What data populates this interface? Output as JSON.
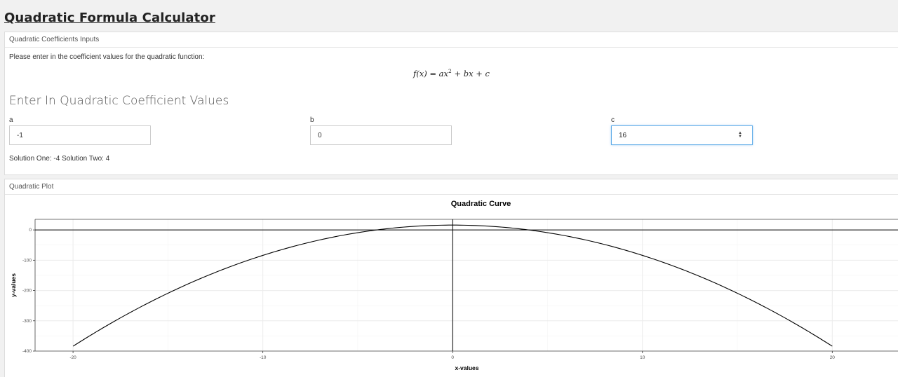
{
  "app": {
    "title": "Quadratic Formula Calculator"
  },
  "coefficients_panel": {
    "heading": "Quadratic Coefficients Inputs",
    "intro": "Please enter in the coefficient values for the quadratic function:",
    "formula": {
      "lhs": "f(x) = ax",
      "exp": "2",
      "rhs": " + bx + c"
    },
    "section_title": "Enter In Quadratic Coefficient Values",
    "fields": {
      "a": {
        "label": "a",
        "value": "-1"
      },
      "b": {
        "label": "b",
        "value": "0"
      },
      "c": {
        "label": "c",
        "value": "16"
      }
    },
    "solution": {
      "one_label": "Solution One:",
      "one": "-4",
      "two_label": "Solution Two:",
      "two": "4"
    }
  },
  "plot_panel": {
    "heading": "Quadratic Plot"
  },
  "chart_data": {
    "type": "line",
    "title": "Quadratic Curve",
    "xlabel": "x-values",
    "ylabel": "y-values",
    "xlim": [
      -22,
      23.5
    ],
    "ylim": [
      -400,
      35
    ],
    "xticks": [
      -20,
      -10,
      0,
      10,
      20
    ],
    "yticks": [
      0,
      -100,
      -200,
      -300,
      -400
    ],
    "xtick_labels": [
      "-20",
      "-10",
      "0",
      "10",
      "20"
    ],
    "ytick_labels": [
      "0",
      "-100",
      "-200",
      "-300",
      "-400"
    ],
    "grid": true,
    "series": [
      {
        "function": "-x^2 + 16",
        "x_range": [
          -20,
          20
        ],
        "coefficients": {
          "a": -1,
          "b": 0,
          "c": 16
        },
        "color": "#000000"
      }
    ],
    "reference_lines": {
      "y": 0,
      "x": 0
    },
    "colors": {
      "curve": "#000000",
      "grid": "#ebebeb",
      "axes": "#000000"
    }
  }
}
